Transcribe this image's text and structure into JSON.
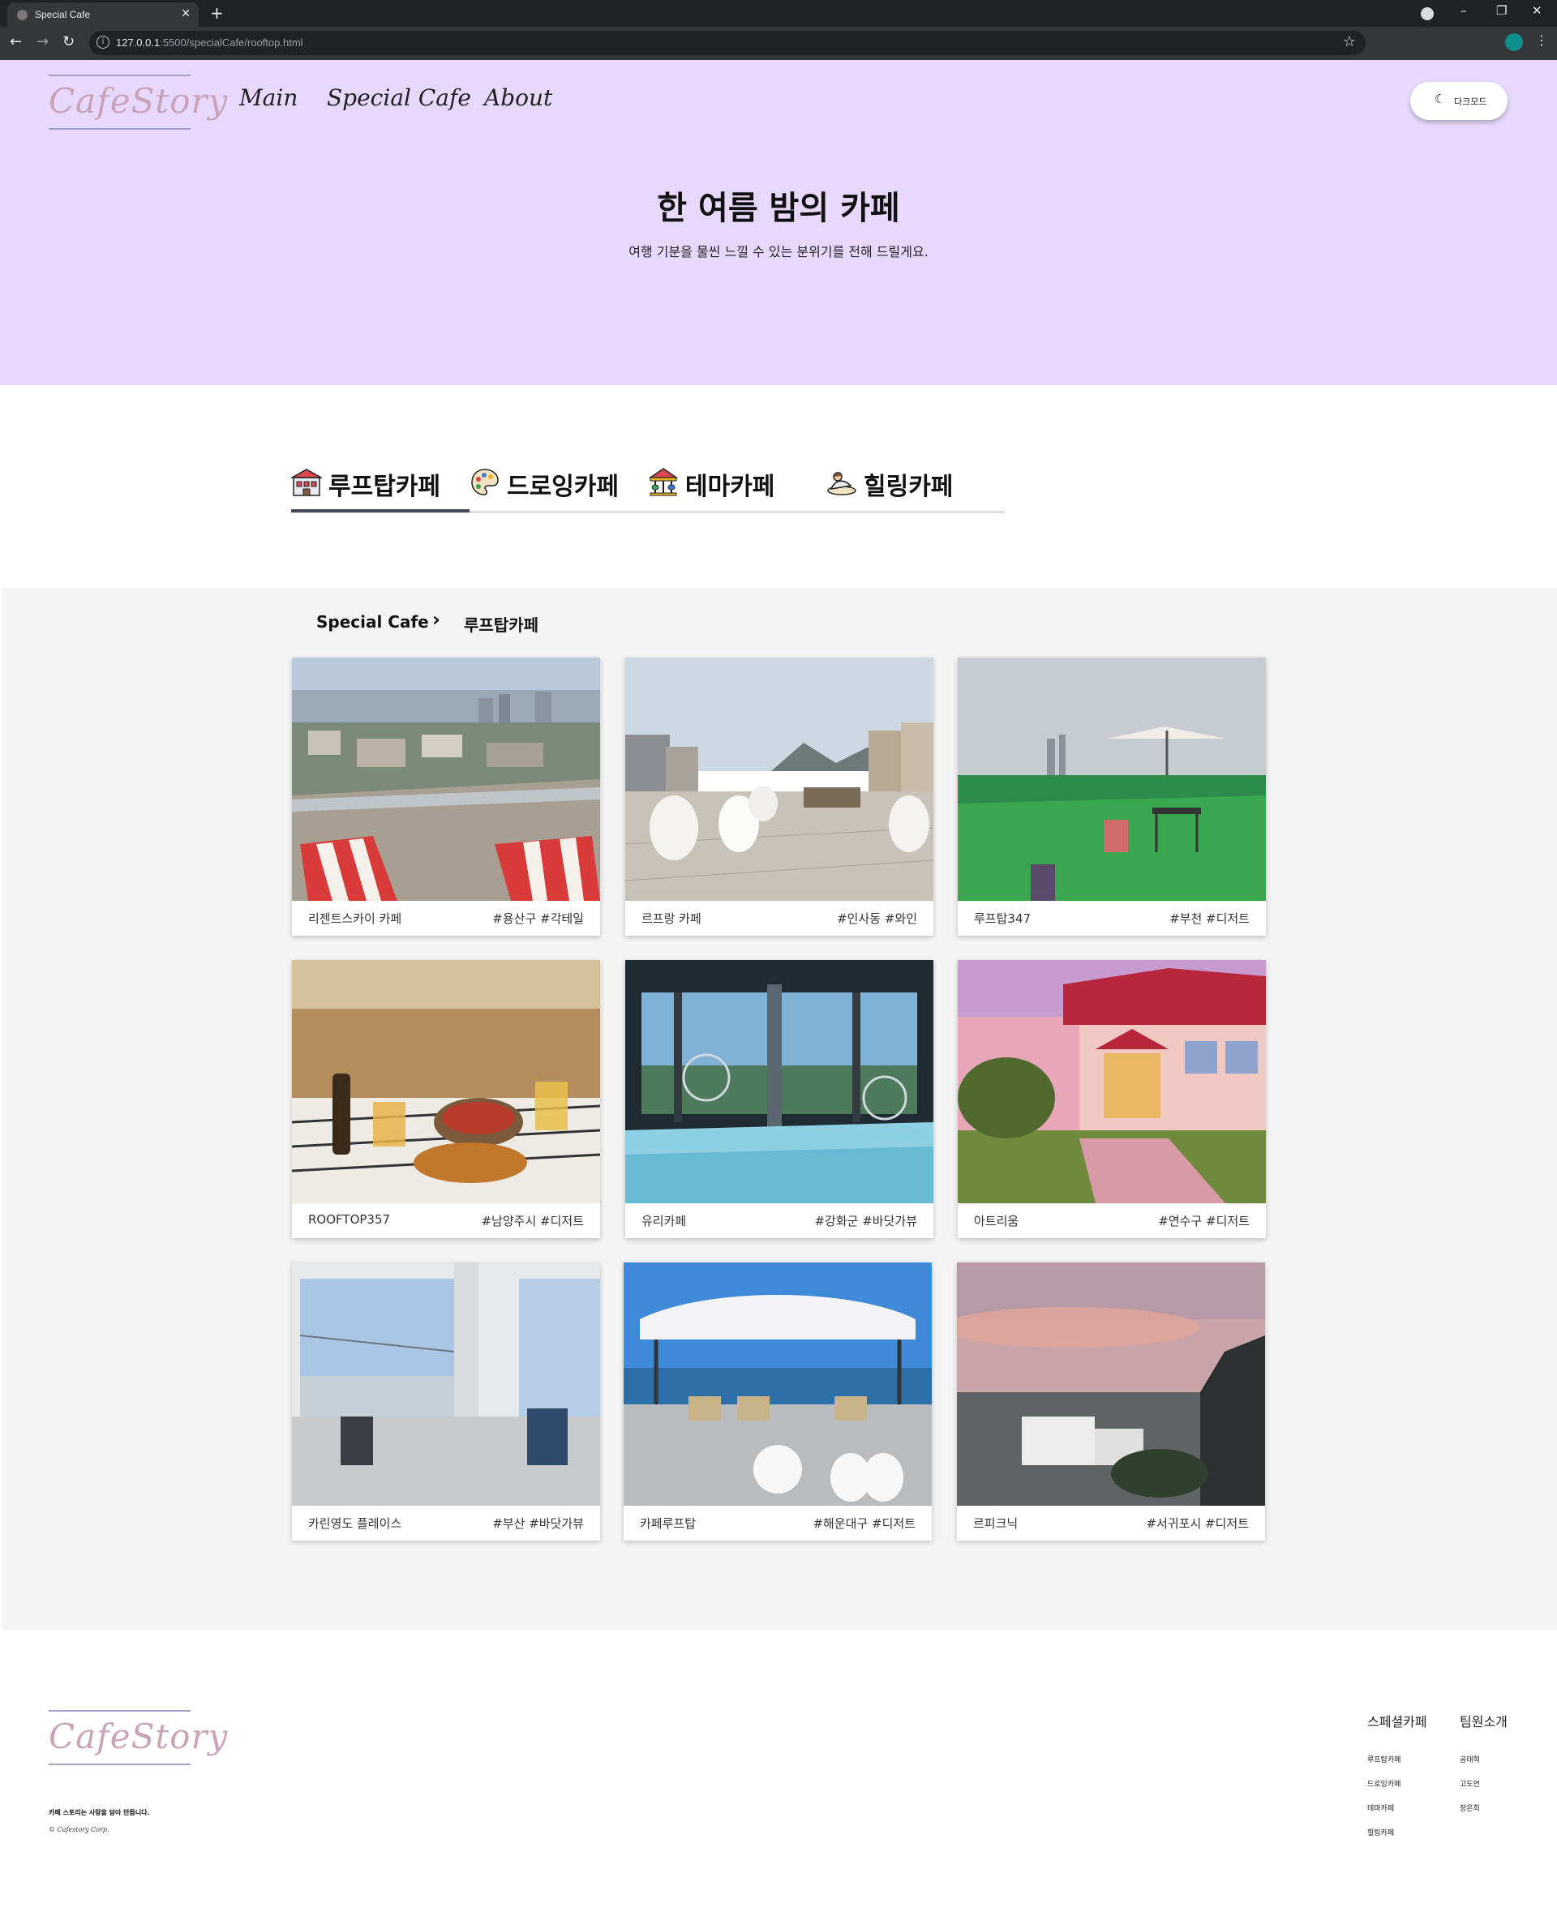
{
  "browser": {
    "tab_title": "Special Cafe",
    "url_host": "127.0.0.1",
    "url_path": ":5500/specialCafe/rooftop.html"
  },
  "header": {
    "logo": "CafeStory",
    "nav": [
      "Main",
      "Special Cafe",
      "About"
    ],
    "dark_mode_label": "다크모드"
  },
  "hero": {
    "title": "한 여름 밤의 카페",
    "subtitle": "여행 기분을 물씬 느낄 수 있는 분위기를 전해 드릴게요."
  },
  "categories": [
    {
      "label": "루프탑카페",
      "icon": "rooftop-building-icon",
      "active": true
    },
    {
      "label": "드로잉카페",
      "icon": "palette-icon",
      "active": false
    },
    {
      "label": "테마카페",
      "icon": "carousel-icon",
      "active": false
    },
    {
      "label": "힐링카페",
      "icon": "spa-icon",
      "active": false
    }
  ],
  "breadcrumb": {
    "root": "Special Cafe",
    "separator": "chevron-right-icon",
    "current": "루프탑카페"
  },
  "cafes": [
    {
      "name": "리젠트스카이 카페",
      "tags": "#용산구 #각테일",
      "scene": "city-rooftop"
    },
    {
      "name": "르프랑 카페",
      "tags": "#인사동 #와인",
      "scene": "white-terrace"
    },
    {
      "name": "루프탑347",
      "tags": "#부천 #디저트",
      "scene": "green-rooftop"
    },
    {
      "name": "ROOFTOP357",
      "tags": "#남양주시 #디저트",
      "scene": "food-table"
    },
    {
      "name": "유리카페",
      "tags": "#강화군 #바닷가뷰",
      "scene": "glass-floor"
    },
    {
      "name": "아트리움",
      "tags": "#연수구 #디저트",
      "scene": "villa-sunset"
    },
    {
      "name": "카린영도 플레이스",
      "tags": "#부산 #바닷가뷰",
      "scene": "window-bridge"
    },
    {
      "name": "카페루프탑",
      "tags": "#해운대구 #디저트",
      "scene": "beach-canopy"
    },
    {
      "name": "르피크닉",
      "tags": "#서귀포시 #디저트",
      "scene": "sunset-coast"
    }
  ],
  "footer": {
    "logo": "CafeStory",
    "tagline": "카페 스토리는 사랑을 담아 만듭니다.",
    "copyright": "© Cafestory Corp.",
    "col1": {
      "title": "스페셜카페",
      "links": [
        "루프탑카페",
        "드로잉카페",
        "테마카페",
        "힐링카페"
      ]
    },
    "col2": {
      "title": "팀원소개",
      "links": [
        "공태혁",
        "고도연",
        "장은희"
      ]
    }
  },
  "colors": {
    "hero_bg": "#e9d8fd",
    "gallery_bg": "#f4f4f4",
    "tab_underline": "#444a5a"
  }
}
